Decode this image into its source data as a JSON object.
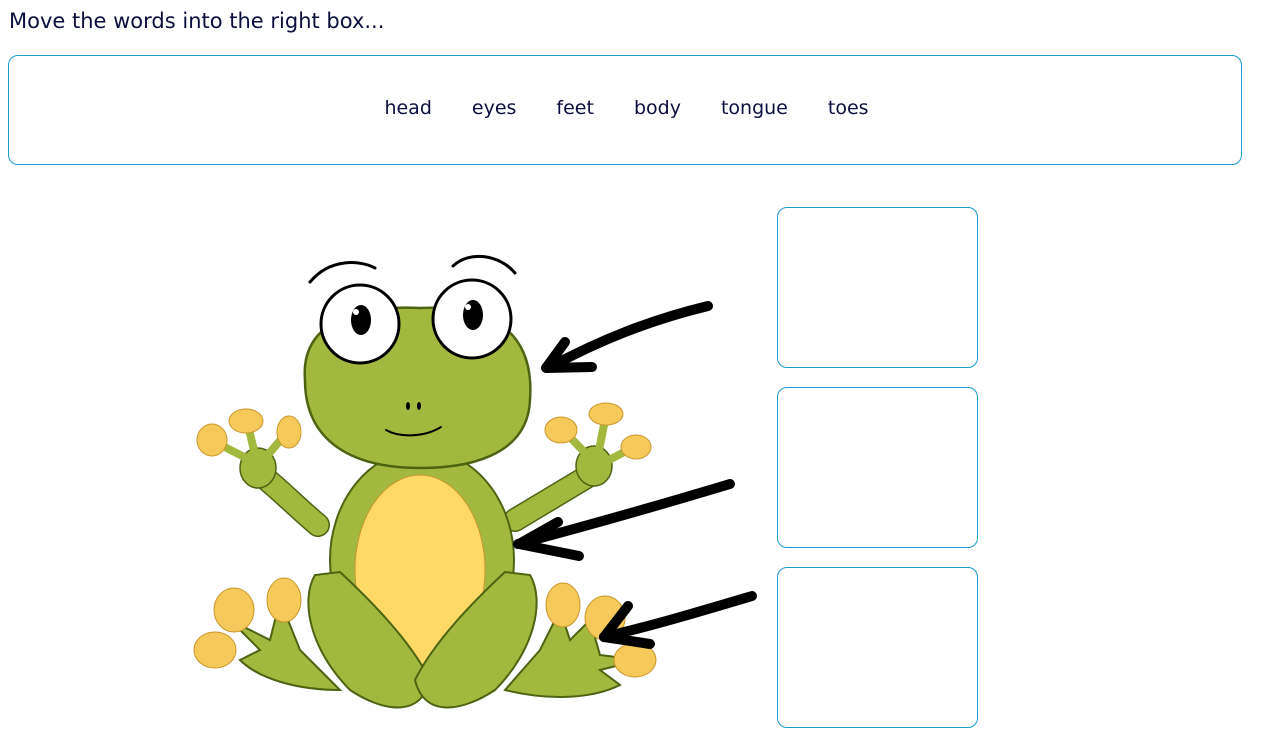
{
  "instruction": "Move the words into the right box...",
  "word_bank": {
    "words": [
      "head",
      "eyes",
      "feet",
      "body",
      "tongue",
      "toes"
    ]
  },
  "drop_boxes": [
    {
      "target": "head",
      "value": ""
    },
    {
      "target": "body",
      "value": ""
    },
    {
      "target": "toes",
      "value": ""
    }
  ],
  "illustration": {
    "subject": "frog",
    "colors": {
      "skin": "#a2b83f",
      "outline": "#4d6312",
      "belly": "#ffd966",
      "toe_pads": "#f5c95a",
      "arrow": "#000000",
      "border": "#1a9ccf"
    }
  }
}
